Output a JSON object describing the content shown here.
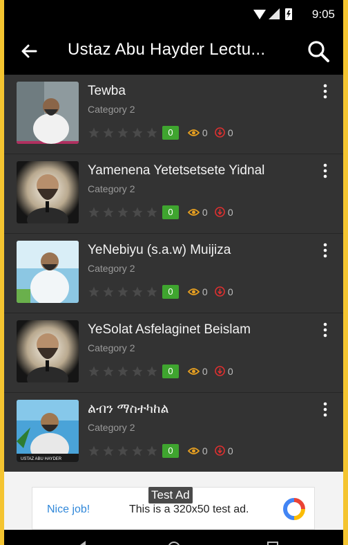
{
  "status": {
    "time": "9:05"
  },
  "appbar": {
    "title": "Ustaz Abu Hayder Lectu..."
  },
  "items": [
    {
      "title": "Tewba",
      "category": "Category 2",
      "badge": "0",
      "views": "0",
      "downloads": "0",
      "rating": 0,
      "icon": "more-vert-icon"
    },
    {
      "title": "Yamenena Yetetsetsete Yidnal",
      "category": "Category 2",
      "badge": "0",
      "views": "0",
      "downloads": "0",
      "rating": 0,
      "icon": "more-vert-icon"
    },
    {
      "title": "YeNebiyu (s.a.w) Muijiza",
      "category": "Category 2",
      "badge": "0",
      "views": "0",
      "downloads": "0",
      "rating": 0,
      "icon": "more-vert-icon"
    },
    {
      "title": "YeSolat Asfelaginet Beislam",
      "category": "Category 2",
      "badge": "0",
      "views": "0",
      "downloads": "0",
      "rating": 0,
      "icon": "more-vert-icon"
    },
    {
      "title": "ልብን ማስተካከል",
      "category": "Category 2",
      "badge": "0",
      "views": "0",
      "downloads": "0",
      "rating": 0,
      "icon": "more-vert-icon"
    }
  ],
  "ad": {
    "tag": "Test Ad",
    "nice": "Nice job!",
    "text": "This is a 320x50 test ad."
  },
  "colors": {
    "badge": "#3fa52f",
    "views": "#e8a020",
    "downloads": "#e03030",
    "accent": "#f4c430"
  }
}
